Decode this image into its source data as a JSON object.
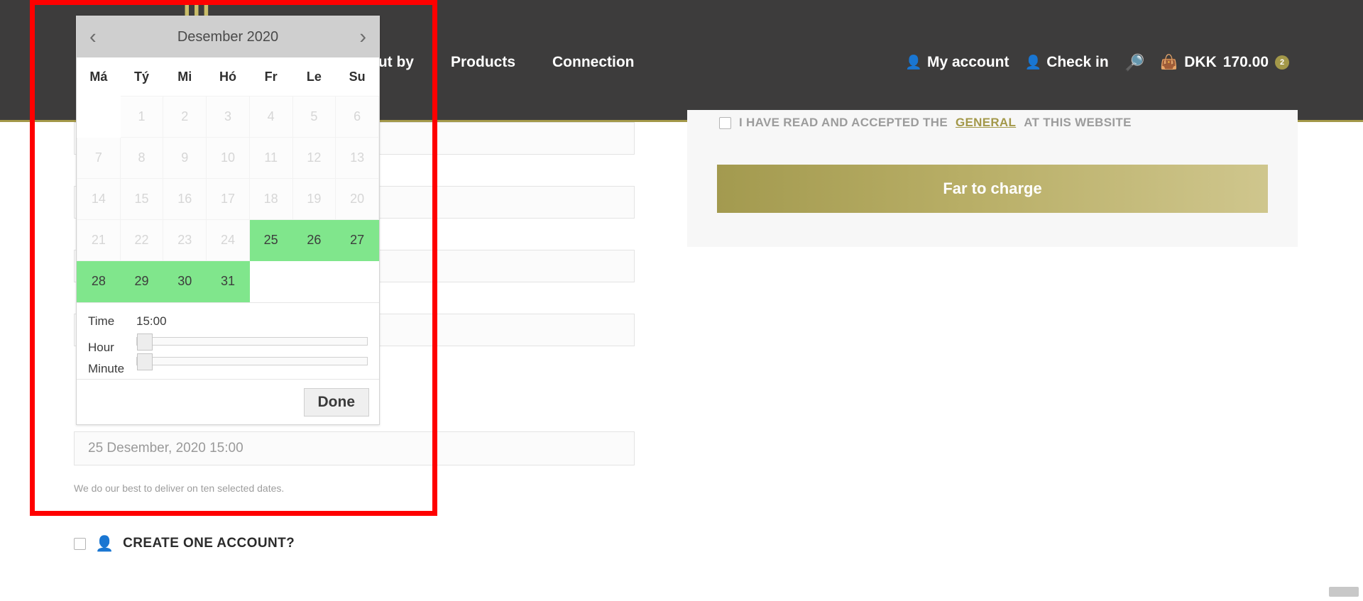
{
  "navbar": {
    "logo": "III",
    "links": [
      {
        "label": "out by"
      },
      {
        "label": "Products"
      },
      {
        "label": "Connection"
      }
    ],
    "account": {
      "label": "My account",
      "icon": "person-icon"
    },
    "checkin": {
      "label": "Check in",
      "icon": "person-icon"
    },
    "search_icon": "search-icon",
    "cart": {
      "icon": "shopping-bag-icon",
      "currency": "DKK",
      "amount": "170.00",
      "badge": "2"
    }
  },
  "datepicker": {
    "prev_icon": "chevron-left-icon",
    "next_icon": "chevron-right-icon",
    "title": "Desember 2020",
    "weekdays": [
      "Má",
      "Tý",
      "Mi",
      "Hó",
      "Fr",
      "Le",
      "Su"
    ],
    "weeks": [
      [
        {
          "day": "",
          "state": "blank"
        },
        {
          "day": "1",
          "state": "disabled"
        },
        {
          "day": "2",
          "state": "disabled"
        },
        {
          "day": "3",
          "state": "disabled"
        },
        {
          "day": "4",
          "state": "disabled"
        },
        {
          "day": "5",
          "state": "disabled"
        },
        {
          "day": "6",
          "state": "disabled"
        }
      ],
      [
        {
          "day": "7",
          "state": "disabled"
        },
        {
          "day": "8",
          "state": "disabled"
        },
        {
          "day": "9",
          "state": "disabled"
        },
        {
          "day": "10",
          "state": "disabled"
        },
        {
          "day": "11",
          "state": "disabled"
        },
        {
          "day": "12",
          "state": "disabled"
        },
        {
          "day": "13",
          "state": "disabled"
        }
      ],
      [
        {
          "day": "14",
          "state": "disabled"
        },
        {
          "day": "15",
          "state": "disabled"
        },
        {
          "day": "16",
          "state": "disabled"
        },
        {
          "day": "17",
          "state": "disabled"
        },
        {
          "day": "18",
          "state": "disabled"
        },
        {
          "day": "19",
          "state": "disabled"
        },
        {
          "day": "20",
          "state": "disabled"
        }
      ],
      [
        {
          "day": "21",
          "state": "disabled"
        },
        {
          "day": "22",
          "state": "disabled"
        },
        {
          "day": "23",
          "state": "disabled"
        },
        {
          "day": "24",
          "state": "disabled"
        },
        {
          "day": "25",
          "state": "available"
        },
        {
          "day": "26",
          "state": "available"
        },
        {
          "day": "27",
          "state": "available"
        }
      ],
      [
        {
          "day": "28",
          "state": "available"
        },
        {
          "day": "29",
          "state": "available"
        },
        {
          "day": "30",
          "state": "available"
        },
        {
          "day": "31",
          "state": "available"
        },
        {
          "day": "",
          "state": "blank"
        },
        {
          "day": "",
          "state": "blank"
        },
        {
          "day": "",
          "state": "blank"
        }
      ]
    ],
    "time_label": "Time",
    "time_value": "15:00",
    "hour_label": "Hour",
    "minute_label": "Minute",
    "done_label": "Done"
  },
  "checkout": {
    "date_input_value": "25 Desember, 2020 15:00",
    "date_help": "We do our best to deliver on ten selected dates.",
    "create_account_label": "CREATE ONE ACCOUNT?",
    "create_account_icon": "user-circle-icon"
  },
  "order": {
    "terms_prefix": "I HAVE READ AND ACCEPTED THE",
    "terms_link": "GENERAL",
    "terms_suffix": "AT THIS WEBSITE",
    "charge_button": "Far to charge"
  },
  "colors": {
    "nav_bg": "#3d3c3c",
    "gold": "#a39849",
    "available_green": "#80e68c",
    "annotation_red": "#ff0000"
  }
}
